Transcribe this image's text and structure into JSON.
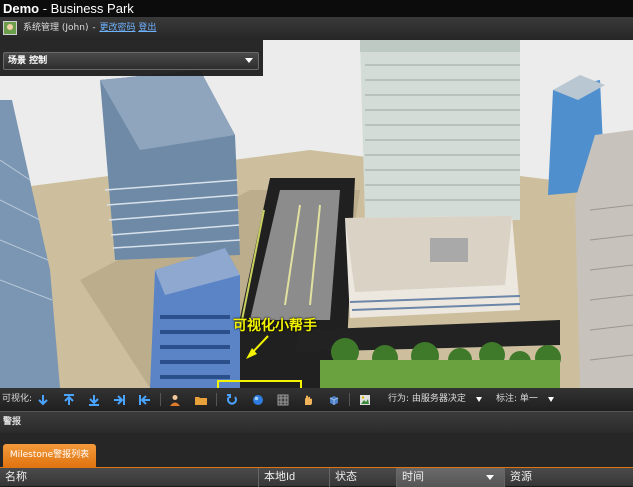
{
  "window": {
    "title_main": "Demo",
    "title_sub": " - Business Park"
  },
  "user": {
    "name": "系统管理 (John)",
    "separator": " - ",
    "change_password": "更改密码",
    "logout": "登出"
  },
  "scene_control": {
    "selected": "场景 控制"
  },
  "annotation": {
    "label": "可视化小帮手"
  },
  "toolbar": {
    "visualize_label": "可视化:",
    "behavior_label": "行为: 由服务器决定",
    "marker_label": "标注: 单一",
    "icons": [
      "arrow-down",
      "arrow-up-bar",
      "arrow-down-bar",
      "arrow-right-bar",
      "arrow-left-bar",
      "person",
      "folder",
      "rotate",
      "sphere",
      "grid",
      "hand",
      "cube",
      "image"
    ]
  },
  "alerts": {
    "header": "警报",
    "tab": "Milestone警报列表",
    "columns": [
      "名称",
      "本地Id",
      "状态",
      "时间",
      "资源"
    ]
  },
  "colors": {
    "accent": "#e8831f",
    "annotation": "#f4f400",
    "link": "#6fb3ff"
  }
}
